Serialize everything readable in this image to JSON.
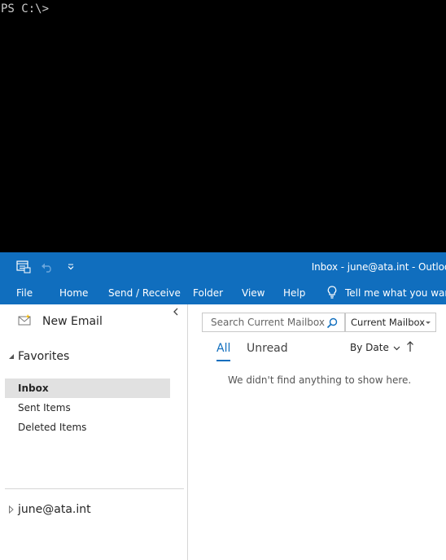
{
  "terminal": {
    "prompt": "PS C:\\>"
  },
  "outlook": {
    "title": "Inbox - june@ata.int  -  Outlook",
    "ribbon": {
      "tabs": [
        "File",
        "Home",
        "Send / Receive",
        "Folder",
        "View",
        "Help"
      ],
      "tell_me": "Tell me what you want to do"
    },
    "folder_pane": {
      "new_email": "New Email",
      "favorites_label": "Favorites",
      "favorites": [
        "Inbox",
        "Sent Items",
        "Deleted Items"
      ],
      "selected": "Inbox",
      "account": "june@ata.int"
    },
    "message_list": {
      "search_placeholder": "Search Current Mailbox",
      "scope": "Current Mailbox",
      "filters": [
        "All",
        "Unread"
      ],
      "active_filter": "All",
      "sort": "By Date",
      "empty_text": "We didn't find anything to show here."
    }
  },
  "colors": {
    "accent": "#106ebe",
    "selected_bg": "#e1e1e1"
  }
}
